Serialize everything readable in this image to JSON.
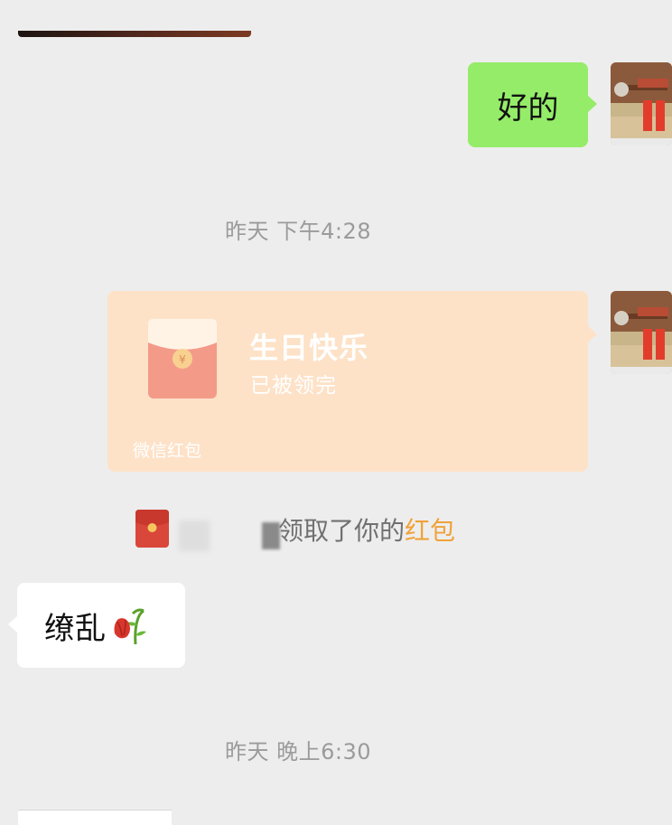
{
  "messages": {
    "first_reply": "好的",
    "timestamp_1": "昨天 下午4:28",
    "red_packet": {
      "title": "生日快乐",
      "status": "已被领完",
      "footer": "微信红包",
      "coin_symbol": "¥"
    },
    "system_notice": {
      "text": "领取了你的",
      "link": "红包"
    },
    "incoming_text": "缭乱",
    "incoming_icon": "wilted-flower-icon",
    "timestamp_2": "昨天 晚上6:30"
  },
  "colors": {
    "background": "#ededed",
    "sent_bubble": "#95ec69",
    "red_packet_card": "#fde2c8",
    "red_packet_link": "#f0a23a"
  }
}
